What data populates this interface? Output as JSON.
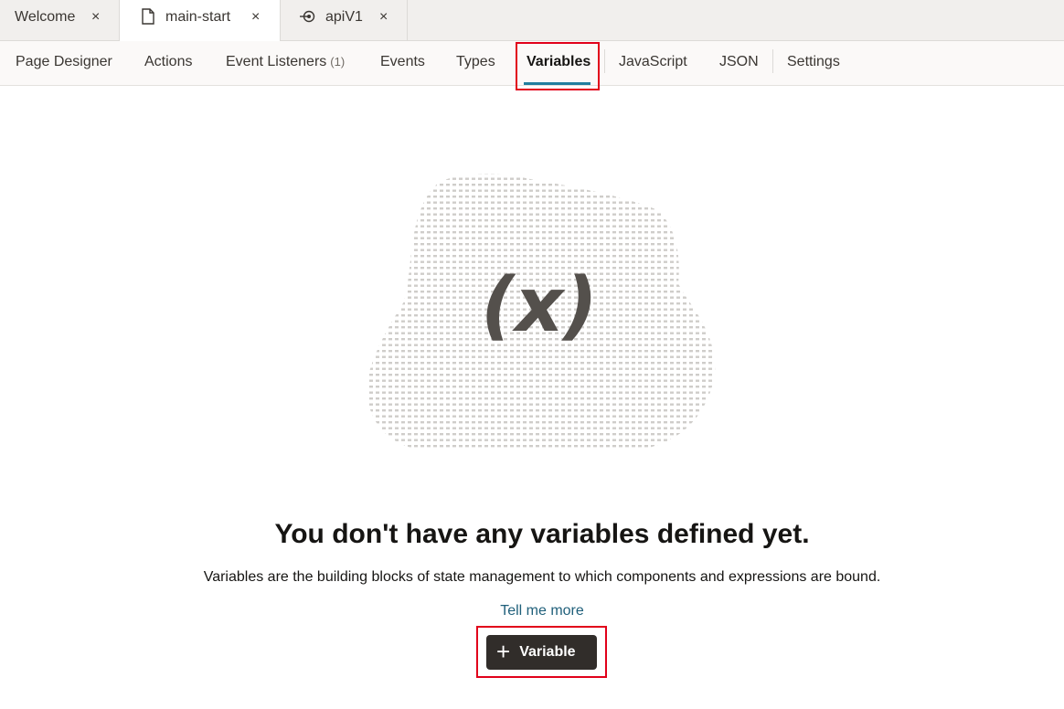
{
  "tabs": [
    {
      "label": "Welcome",
      "icon": "",
      "active": false
    },
    {
      "label": "main-start",
      "icon": "file-icon",
      "active": true
    },
    {
      "label": "apiV1",
      "icon": "service-connection-icon",
      "active": false
    }
  ],
  "tab_close_glyph": "×",
  "subnav": {
    "items": [
      {
        "label": "Page Designer"
      },
      {
        "label": "Actions"
      },
      {
        "label": "Event Listeners",
        "count": "(1)"
      },
      {
        "label": "Events"
      },
      {
        "label": "Types"
      },
      {
        "label": "Variables",
        "active": true
      },
      {
        "label": "JavaScript"
      },
      {
        "label": "JSON"
      },
      {
        "label": "Settings"
      }
    ]
  },
  "empty_state": {
    "illustration_symbol": "(x)",
    "heading": "You don't have any variables defined yet.",
    "description": "Variables are the building blocks of state management to which components and expressions are bound.",
    "link": "Tell me more",
    "button_icon": "+",
    "button_label": "Variable"
  },
  "colors": {
    "accent": "#227e9e",
    "highlight": "#e1001a",
    "button_bg": "#312d2a",
    "link": "#1f5f7a"
  }
}
